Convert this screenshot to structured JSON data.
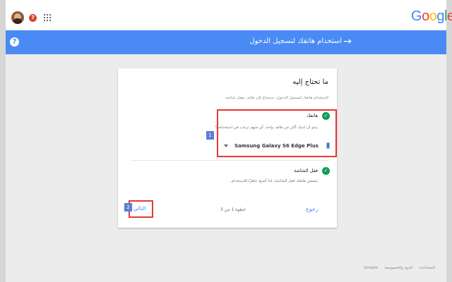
{
  "header": {
    "notifications_count": "7",
    "logo_letters": [
      "G",
      "o",
      "o",
      "g",
      "l",
      "e"
    ]
  },
  "bluebar": {
    "help_symbol": "?",
    "title": "استخدام هاتفك لتسجيل الدخول",
    "back_arrow": "→"
  },
  "card": {
    "title": "ما تحتاج إليه",
    "description": "لاستخدام هاتفك لتسجيل الدخول، ستحتاج إلى هاتف بقفل شاشة.",
    "section_phone": {
      "title": "هاتفك",
      "description": "يبدو أن لديك أكثر من هاتف واحد. أي منهم ترغب في استخدامه؟",
      "device": "Samsung Galaxy S6 Edge Plus"
    },
    "section_lock": {
      "title": "قفل الشاشة",
      "description": "يتضمن هاتفك قفل الشاشة. لذا أصبح جاهزًا للاستخدام."
    },
    "badges": [
      "1",
      "2"
    ],
    "buttons": {
      "back": "رجوع",
      "step": "خطوة 1 من 3",
      "next": "التالي"
    }
  },
  "footer": {
    "links": [
      "Google",
      "البنود والخصوصية",
      "المساعدة"
    ]
  },
  "colors": {
    "accent_blue": "#4a8af4",
    "highlight_red": "#e53935",
    "check_green": "#0f9d58",
    "badge_blue": "#5b7fd6"
  }
}
